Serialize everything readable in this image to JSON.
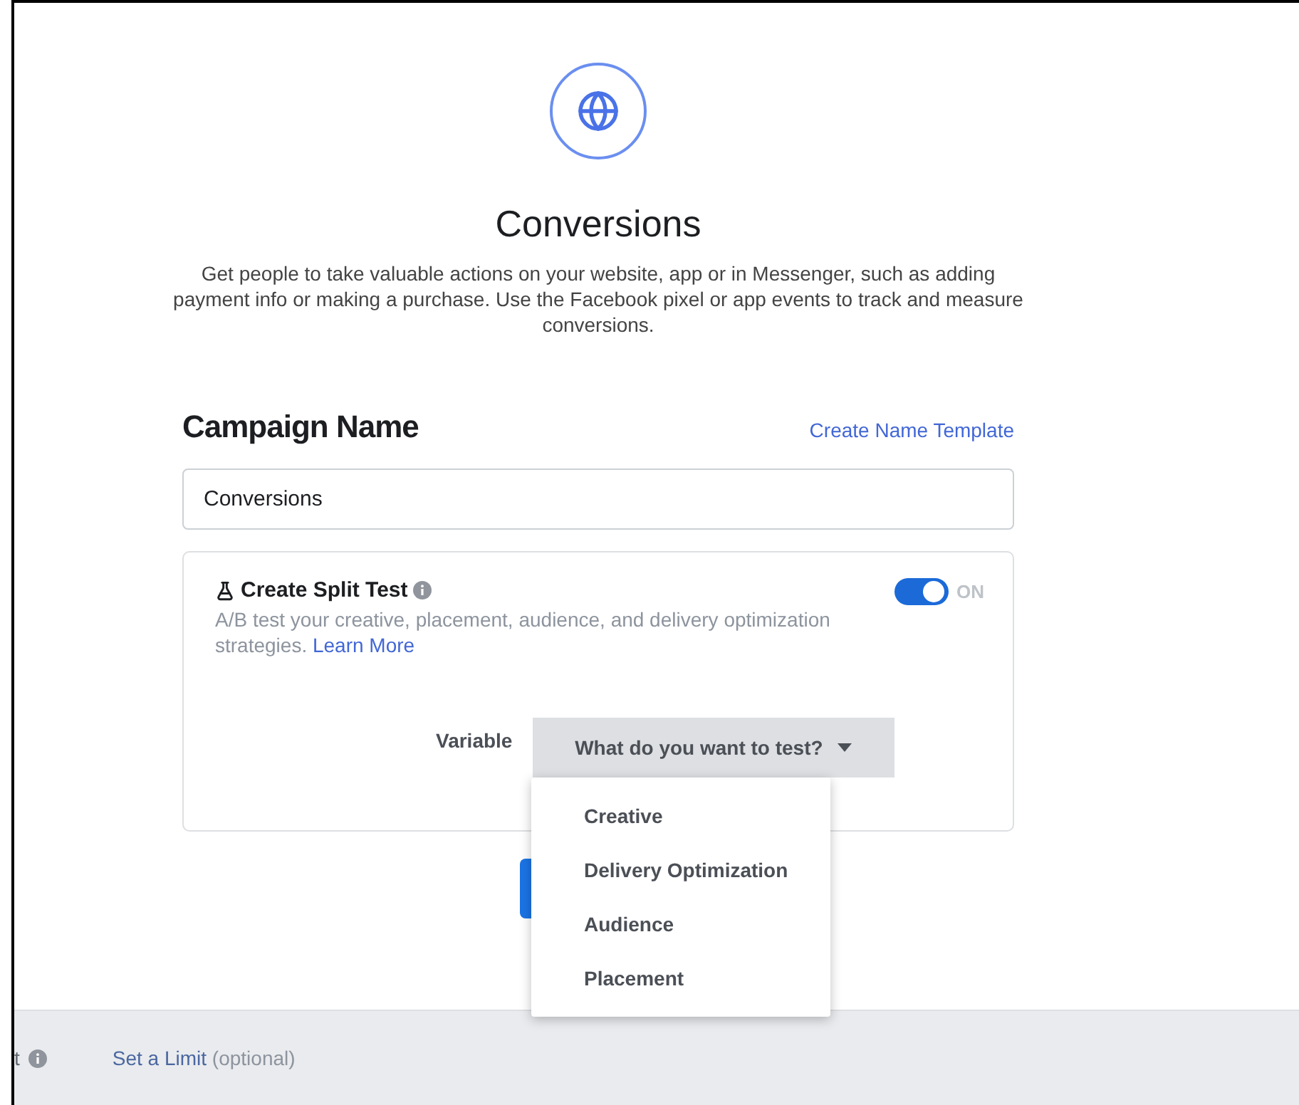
{
  "objective": {
    "title": "Conversions",
    "description": "Get people to take valuable actions on your website, app or in Messenger, such as adding payment info or making a purchase. Use the Facebook pixel or app events to track and measure conversions."
  },
  "campaign_name": {
    "heading": "Campaign Name",
    "template_link": "Create Name Template",
    "value": "Conversions"
  },
  "split_test": {
    "title": "Create Split Test",
    "on": true,
    "state_label": "ON",
    "description": "A/B test your creative, placement, audience, and delivery optimization strategies.",
    "learn_more": "Learn More",
    "variable_label": "Variable",
    "dropdown": {
      "value": "What do you want to test?",
      "expanded": true,
      "options": [
        {
          "label": "Creative"
        },
        {
          "label": "Delivery Optimization"
        },
        {
          "label": "Audience"
        },
        {
          "label": "Placement"
        }
      ]
    }
  },
  "footer": {
    "label": "t",
    "link": "Set a Limit",
    "hint": "(optional)"
  }
}
